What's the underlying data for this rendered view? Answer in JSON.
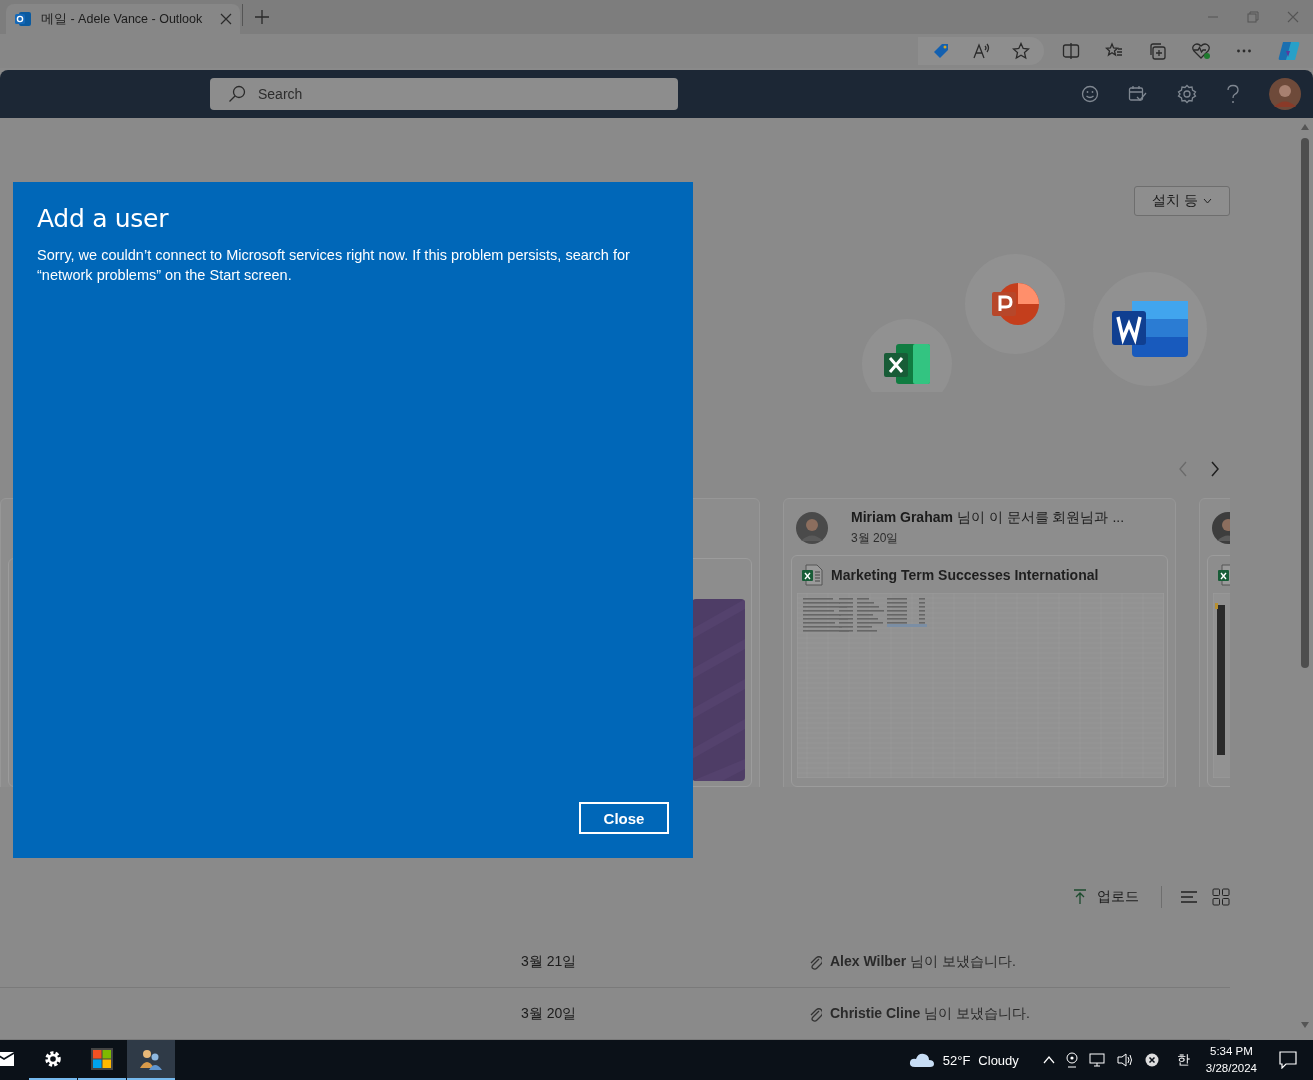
{
  "browser": {
    "tab_title": "메일 - Adele Vance - Outlook"
  },
  "header": {
    "search": {
      "placeholder": "Search"
    }
  },
  "home": {
    "install_button": "설치 등",
    "shared_card": {
      "title": "**Miriam Graham** 님이 이 문서를 회원님과 ...",
      "date": "3월 20일",
      "file_name": "Marketing Term Successes International"
    },
    "upload_button": "업로드",
    "files": [
      {
        "date": "3월 21일",
        "sender": "**Alex Wilber** 님이 보냈습니다."
      },
      {
        "date": "3월 20일",
        "sender": "**Christie Cline** 님이 보냈습니다."
      }
    ]
  },
  "dialog": {
    "title": "Add a user",
    "message": "Sorry, we couldn’t connect to Microsoft services right now. If this problem persists, search for “network problems” on the Start screen.",
    "button": "Close"
  },
  "taskbar": {
    "apps": [
      {
        "kind": "mail",
        "open": false,
        "selected": false
      },
      {
        "kind": "settings",
        "open": true,
        "selected": false
      },
      {
        "kind": "store",
        "open": true,
        "selected": false
      },
      {
        "kind": "people",
        "open": true,
        "selected": true
      }
    ],
    "weather": {
      "temperature": "52°F",
      "condition": "Cloudy"
    },
    "ime": "한",
    "time": "5:34 PM",
    "date": "3/28/2024"
  }
}
